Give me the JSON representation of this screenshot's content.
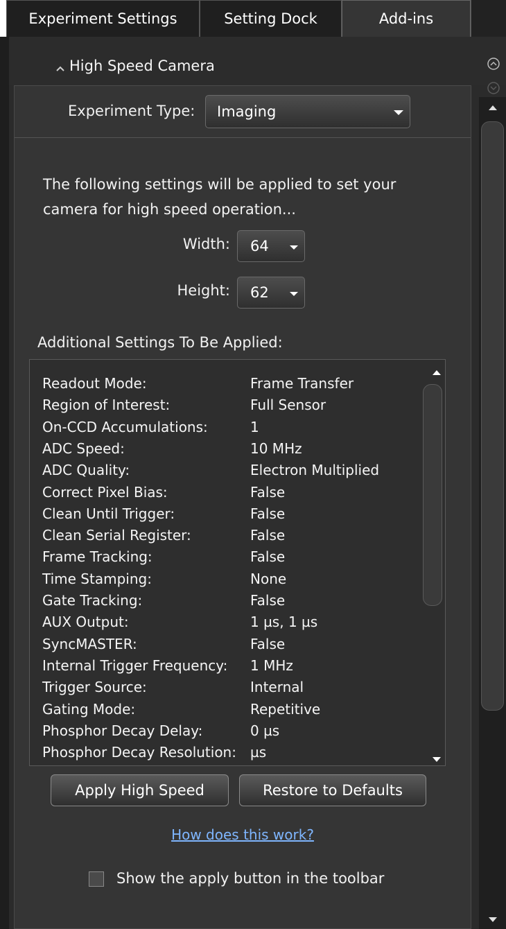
{
  "tabs": [
    {
      "label": "Experiment Settings",
      "selected": false
    },
    {
      "label": "Setting Dock",
      "selected": false
    },
    {
      "label": "Add-ins",
      "selected": true
    }
  ],
  "section": {
    "title": "High Speed Camera",
    "collapse_icon": "chevron-up-icon",
    "scroll_up_icon": "circle-chevron-up-icon",
    "scroll_down_icon": "circle-chevron-down-icon"
  },
  "experiment_type": {
    "label": "Experiment Type:",
    "value": "Imaging"
  },
  "intro_text": "The following settings will be applied to set your camera for high speed operation...",
  "dimensions": {
    "width_label": "Width:",
    "width_value": "64",
    "height_label": "Height:",
    "height_value": "62"
  },
  "additional_settings": {
    "title": "Additional Settings To Be Applied:",
    "rows": [
      {
        "name": "Readout Mode:",
        "value": "Frame Transfer"
      },
      {
        "name": "Region of Interest:",
        "value": "Full Sensor"
      },
      {
        "name": "On-CCD Accumulations:",
        "value": "1"
      },
      {
        "name": "ADC Speed:",
        "value": "10 MHz"
      },
      {
        "name": "ADC Quality:",
        "value": "Electron Multiplied"
      },
      {
        "name": "Correct Pixel Bias:",
        "value": "False"
      },
      {
        "name": "Clean Until Trigger:",
        "value": "False"
      },
      {
        "name": "Clean Serial Register:",
        "value": "False"
      },
      {
        "name": "Frame Tracking:",
        "value": "False"
      },
      {
        "name": "Time Stamping:",
        "value": "None"
      },
      {
        "name": "Gate Tracking:",
        "value": "False"
      },
      {
        "name": "AUX Output:",
        "value": "1 µs, 1 µs"
      },
      {
        "name": "SyncMASTER:",
        "value": "False"
      },
      {
        "name": "Internal Trigger Frequency:",
        "value": "1 MHz"
      },
      {
        "name": "Trigger Source:",
        "value": "Internal"
      },
      {
        "name": "Gating Mode:",
        "value": "Repetitive"
      },
      {
        "name": "Phosphor Decay Delay:",
        "value": "0 µs"
      },
      {
        "name": "Phosphor Decay Resolution:",
        "value": "µs"
      }
    ]
  },
  "buttons": {
    "apply": "Apply High Speed",
    "restore": "Restore to Defaults"
  },
  "help_link": "How does this work?",
  "toolbar_option": {
    "label": "Show the apply button in the toolbar",
    "checked": false
  },
  "colors": {
    "panel_bg": "#353535",
    "link": "#7fb6ff"
  }
}
